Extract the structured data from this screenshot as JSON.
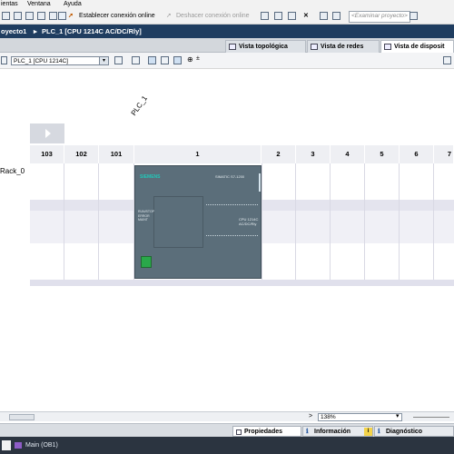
{
  "menu": {
    "items": [
      "ientas",
      "Ventana",
      "Ayuda"
    ]
  },
  "toolbar": {
    "connect_online_label": "Establecer conexión online",
    "disconnect_online_label": "Deshacer conexión online",
    "search_placeholder": "<Examinar proyecto>"
  },
  "breadcrumb": {
    "project": "oyecto1",
    "separator": "▸",
    "device": "PLC_1 [CPU 1214C AC/DC/Rly]"
  },
  "view_tabs": {
    "topology": "Vista topológica",
    "network": "Vista de redes",
    "device": "Vista de disposit"
  },
  "device_toolbar": {
    "selected_device": "PLC_1 [CPU 1214C]"
  },
  "canvas": {
    "plc_name": "PLC_1",
    "rack_name": "Rack_0",
    "slot_headers": [
      "103",
      "102",
      "101",
      "1",
      "2",
      "3",
      "4",
      "5",
      "6",
      "7"
    ],
    "cpu": {
      "brand": "SIEMENS",
      "series": "SIMATIC S7-1200",
      "model_line1": "CPU 1214C",
      "model_line2": "AC/DC/Rly",
      "status_labels": [
        "RUN/STOP",
        "ERROR",
        "MAINT"
      ],
      "color_body": "#5b6e7a",
      "color_brand": "#22c7b8"
    }
  },
  "zoom": {
    "value": "138%"
  },
  "inspector_tabs": {
    "properties": "Propiedades",
    "info": "Información",
    "diagnostics": "Diagnóstico"
  },
  "taskbar": {
    "item": "Main (OB1)"
  }
}
